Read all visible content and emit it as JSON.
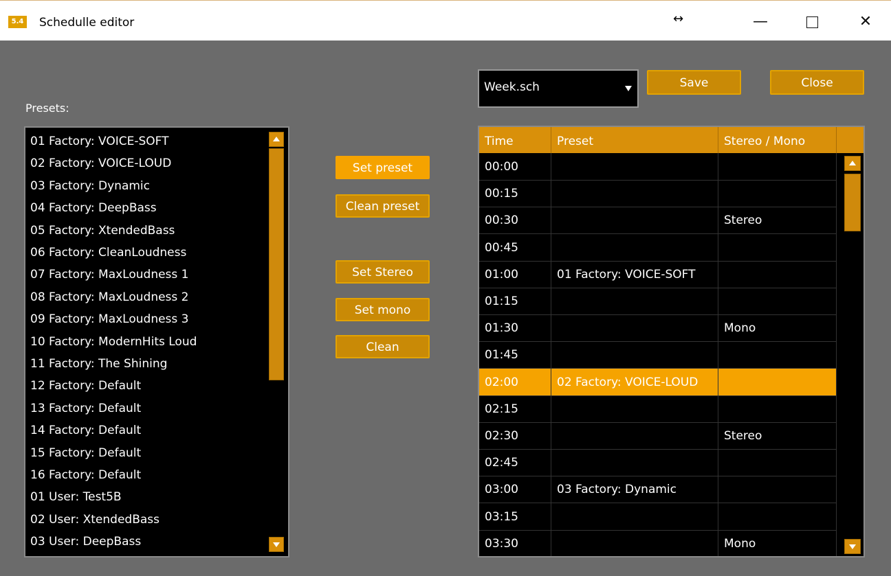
{
  "window": {
    "app_icon_text": "5.4",
    "title": "Schedulle editor",
    "resize_icon": "↔",
    "minimize": "—",
    "close": "✕"
  },
  "presets": {
    "label": "Presets:",
    "items": [
      "01 Factory: VOICE-SOFT",
      "02 Factory: VOICE-LOUD",
      "03 Factory: Dynamic",
      "04 Factory: DeepBass",
      "05 Factory: XtendedBass",
      "06 Factory: CleanLoudness",
      "07 Factory: MaxLoudness 1",
      "08 Factory: MaxLoudness 2",
      "09 Factory: MaxLoudness 3",
      "10 Factory: ModernHits Loud",
      "11 Factory: The Shining",
      "12 Factory: Default",
      "13 Factory: Default",
      "14 Factory: Default",
      "15 Factory: Default",
      "16 Factory: Default",
      "01 User: Test5B",
      "02 User: XtendedBass",
      "03 User: DeepBass"
    ]
  },
  "actions": {
    "set_preset": "Set preset",
    "clean_preset": "Clean preset",
    "set_stereo": "Set Stereo",
    "set_mono": "Set mono",
    "clean": "Clean"
  },
  "toolbar": {
    "schedule_file": "Week.sch",
    "save": "Save",
    "close": "Close"
  },
  "schedule": {
    "columns": [
      "Time",
      "Preset",
      "Stereo / Mono"
    ],
    "rows": [
      {
        "time": "00:00",
        "preset": "",
        "mode": ""
      },
      {
        "time": "00:15",
        "preset": "",
        "mode": ""
      },
      {
        "time": "00:30",
        "preset": "",
        "mode": "Stereo"
      },
      {
        "time": "00:45",
        "preset": "",
        "mode": ""
      },
      {
        "time": "01:00",
        "preset": "01 Factory: VOICE-SOFT",
        "mode": ""
      },
      {
        "time": "01:15",
        "preset": "",
        "mode": ""
      },
      {
        "time": "01:30",
        "preset": "",
        "mode": "Mono"
      },
      {
        "time": "01:45",
        "preset": "",
        "mode": ""
      },
      {
        "time": "02:00",
        "preset": "02 Factory: VOICE-LOUD",
        "mode": "",
        "selected": true
      },
      {
        "time": "02:15",
        "preset": "",
        "mode": ""
      },
      {
        "time": "02:30",
        "preset": "",
        "mode": "Stereo"
      },
      {
        "time": "02:45",
        "preset": "",
        "mode": ""
      },
      {
        "time": "03:00",
        "preset": "03 Factory: Dynamic",
        "mode": ""
      },
      {
        "time": "03:15",
        "preset": "",
        "mode": ""
      },
      {
        "time": "03:30",
        "preset": "",
        "mode": "Mono"
      }
    ]
  },
  "colors": {
    "accent": "#f5a300",
    "accent_dark": "#c98a06",
    "background": "#6b6b6b"
  }
}
